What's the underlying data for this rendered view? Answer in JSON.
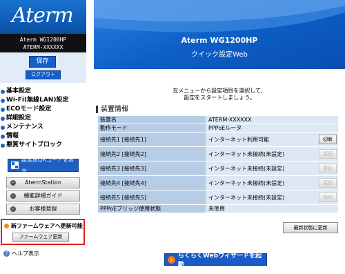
{
  "sidebar": {
    "logo": "Aterm",
    "model_line1": "Aterm WG1200HP",
    "model_line2": "ATERM-XXXXXX",
    "save_label": "保存",
    "logout_label": "ログアウト",
    "menu": [
      "基本設定",
      "Wi-Fi(無線LAN)設定",
      "ECOモード設定",
      "詳細設定",
      "メンテナンス",
      "情報",
      "悪質サイトブロック"
    ],
    "qr_label": "設定用QRコードを表示",
    "buttons": [
      "AtermStation",
      "機能詳細ガイド",
      "お客様登録"
    ],
    "firmware_notice": "新ファームウェアへ更新可能",
    "firmware_button": "ファームウェア更新",
    "help_label": "ヘルプ表示"
  },
  "banner": {
    "title": "Aterm WG1200HP",
    "subtitle": "クイック設定Web"
  },
  "intro": {
    "line1": "左メニューから設定項目を選択して、",
    "line2": "設定をスタートしましょう。"
  },
  "section_title": "装置情報",
  "info_rows": [
    {
      "key": "装置名",
      "value": "ATERM-XXXXXX",
      "action": ""
    },
    {
      "key": "動作モード",
      "value": "PPPoEルータ",
      "action": ""
    },
    {
      "key": "接続先1 [接続先1]",
      "value": "インターネット利用可能",
      "action": "切断"
    },
    {
      "key": "接続先2 [接続先2]",
      "value": "インターネット未接続(未設定)",
      "action": "接続"
    },
    {
      "key": "接続先3 [接続先3]",
      "value": "インターネット未接続(未設定)",
      "action": "接続"
    },
    {
      "key": "接続先4 [接続先4]",
      "value": "インターネット未接続(未設定)",
      "action": "接続"
    },
    {
      "key": "接続先5 [接続先5]",
      "value": "インターネット未接続(未設定)",
      "action": "接続"
    },
    {
      "key": "PPPoEブリッジ使用状態",
      "value": "未使用",
      "action": ""
    }
  ],
  "refresh_label": "最新状態に更新",
  "wizard_label": "らくらくWebウィザードを起動",
  "colors": {
    "brand_blue": "#0d5fc6",
    "alert_red": "#e02020",
    "notice_orange": "#f28a1a"
  }
}
